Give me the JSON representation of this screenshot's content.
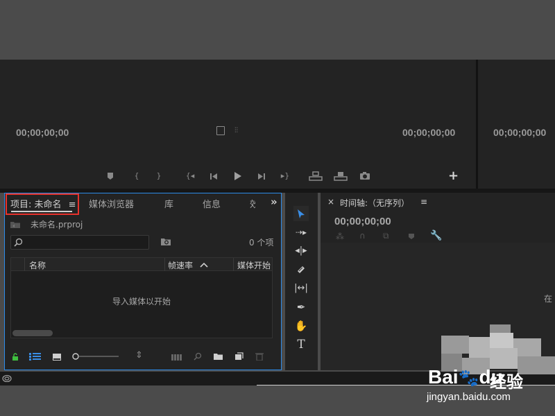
{
  "source_monitor": {
    "timecode_left": "00;00;00;00",
    "timecode_right": "00;00;00;00",
    "add_button": "+"
  },
  "program_monitor": {
    "timecode": "00;00;00;00"
  },
  "project_panel": {
    "tabs": [
      "项目: 未命名",
      "媒体浏览器",
      "库",
      "信息",
      "效"
    ],
    "tab_menu_icon": "≡",
    "more_tabs_icon": "»",
    "project_file": "未命名.prproj",
    "search_placeholder": "",
    "item_count": "0 个项",
    "columns": [
      "名称",
      "帧速率",
      "媒体开始"
    ],
    "empty_message": "导入媒体以开始"
  },
  "tools": [
    "selection-tool",
    "track-select-tool",
    "ripple-edit-tool",
    "razor-tool",
    "slip-tool",
    "pen-tool",
    "hand-tool",
    "type-tool"
  ],
  "timeline": {
    "close": "×",
    "title": "时间轴:（无序列）",
    "menu": "≡",
    "timecode": "00;00;00;00",
    "drop_hint": "在"
  },
  "watermark": {
    "logo_text": "Bai",
    "logo_text2": "du",
    "brand": "经验",
    "url": "jingyan.baidu.com"
  },
  "colors": {
    "accent": "#2d8ceb",
    "highlight": "#e8322c",
    "panel": "#232323"
  }
}
